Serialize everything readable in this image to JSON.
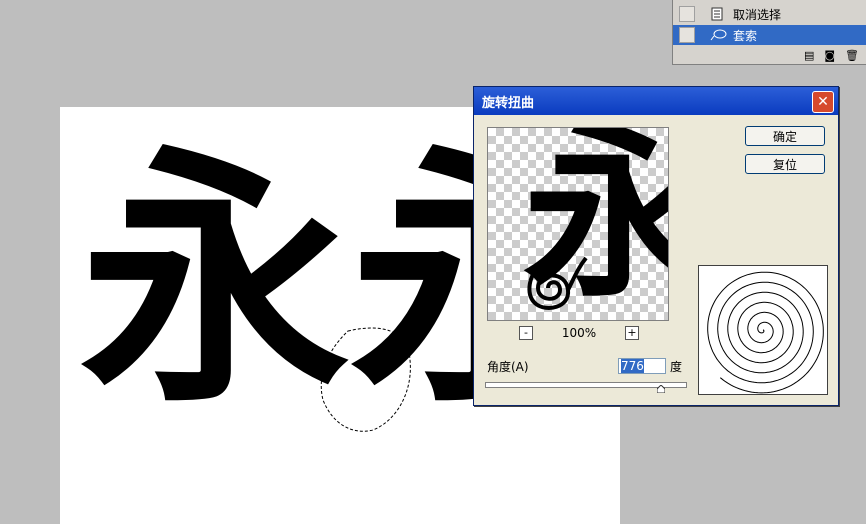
{
  "canvas": {
    "glyph1": "永",
    "glyph2": "永"
  },
  "history": {
    "items": [
      {
        "label": "取消选择",
        "icon": "history-step-icon",
        "selected": false
      },
      {
        "label": "套索",
        "icon": "lasso-icon",
        "selected": true
      }
    ]
  },
  "dialog": {
    "title": "旋转扭曲",
    "ok_label": "确定",
    "reset_label": "复位",
    "zoom_minus": "-",
    "zoom_plus": "+",
    "zoom_level": "100%",
    "preview_glyph": "永",
    "angle_label": "角度(A)",
    "angle_value": "776",
    "angle_unit": "度",
    "angle_fraction": 0.88
  }
}
